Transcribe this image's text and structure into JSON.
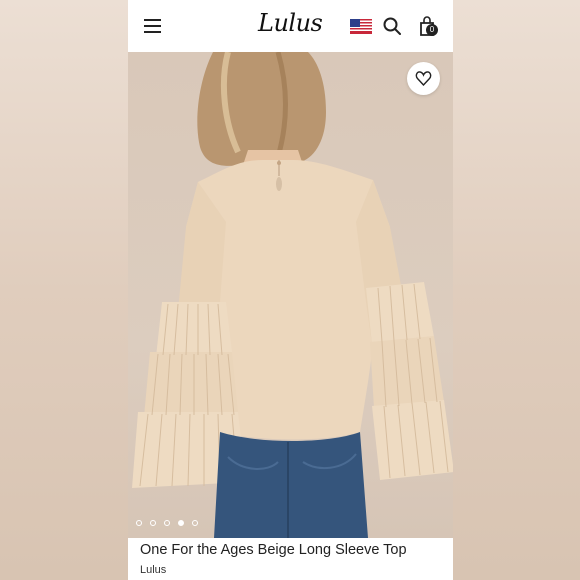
{
  "header": {
    "logo_text": "Lulus",
    "menu_icon": "hamburger-menu-icon",
    "region_icon": "us-flag-icon",
    "search_icon": "search-icon",
    "bag_icon": "shopping-bag-icon",
    "bag_count": "0"
  },
  "gallery": {
    "wishlist_icon": "heart-icon",
    "slide_count": 5,
    "active_slide": 4
  },
  "product": {
    "title": "One For the Ages Beige Long Sleeve Top",
    "brand": "Lulus"
  },
  "colors": {
    "blouse": "#ecd7bd",
    "jeans": "#35557c",
    "hair": "#b99670",
    "text": "#222222"
  }
}
